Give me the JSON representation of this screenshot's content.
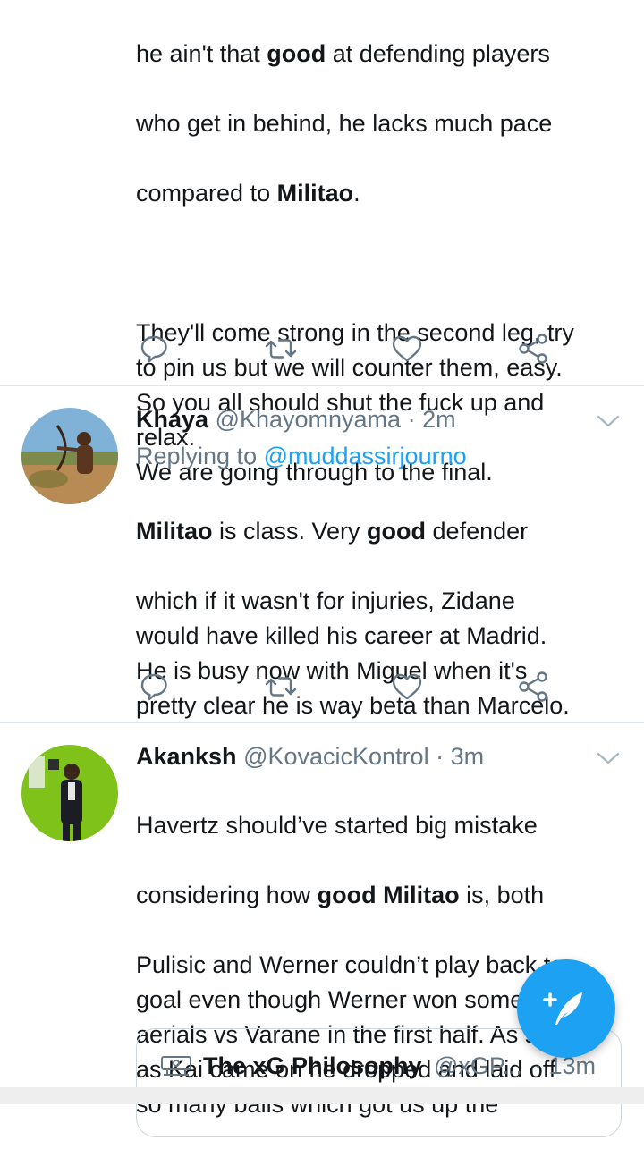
{
  "tweet1": {
    "line1": {
      "pre": "he ain't that ",
      "bold": "good",
      "post": " at defending players"
    },
    "line2": "who get in behind, he lacks much pace",
    "line3": {
      "pre": "compared to ",
      "bold": "Militao",
      "post": "."
    },
    "para2": "They'll come strong in the second leg, try\nto pin us but we will counter them, easy.\nSo you all should shut the fuck up and\nrelax.\nWe are going through to the final."
  },
  "tweet2": {
    "name": "Khaya",
    "handle": "@Khayomnyama",
    "dot": " · ",
    "time": "2m",
    "replying_prefix": "Replying to ",
    "replying_handle": "@muddassirjourno",
    "line1": {
      "bold1": "Militao",
      "mid": " is class. Very ",
      "bold2": "good",
      "post": " defender"
    },
    "rest": "which if it wasn't for injuries, Zidane\nwould have killed his career at Madrid.\nHe is busy now with Miguel when it's\npretty clear he is way beta than Marcelo."
  },
  "tweet3": {
    "name": "Akanksh",
    "handle": "@KovacicKontrol",
    "dot": " · ",
    "time": "3m",
    "line1": "Havertz should’ve started big mistake",
    "line2": {
      "pre": "considering how ",
      "bold": "good Militao",
      "post": " is, both"
    },
    "rest": "Pulisic and Werner couldn’t play back to\ngoal even though Werner won some\naerials vs Varane in the first half. As soon\nas Kai came on he dropped and laid off\nso many balls which got us up the",
    "quote": {
      "name": "The xG Philosophy",
      "handle": "@xGP...",
      "time": "· 13m"
    }
  },
  "icons": {
    "reply": "reply-icon",
    "retweet": "retweet-icon",
    "like": "heart-icon",
    "share": "share-icon",
    "more": "chevron-down-icon",
    "compose": "compose-tweet-icon"
  },
  "colors": {
    "accent": "#1da1f2",
    "muted": "#657786",
    "text": "#14171a",
    "divider": "#e1e8ed"
  }
}
